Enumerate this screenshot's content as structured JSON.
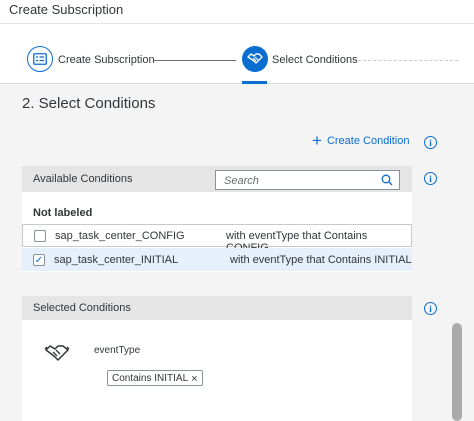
{
  "window": {
    "title": "Create Subscription"
  },
  "wizard": {
    "steps": [
      {
        "label": "Create Subscription",
        "icon": "form-icon",
        "state": "completed"
      },
      {
        "label": "Select Conditions",
        "icon": "handshake-icon",
        "state": "active"
      }
    ],
    "accent": "#0a6ed1"
  },
  "section": {
    "title": "2. Select Conditions"
  },
  "toolbar": {
    "create_condition_label": "Create Condition",
    "plus_glyph": "+"
  },
  "info_glyph": "i",
  "available": {
    "header": "Available Conditions",
    "search_placeholder": "Search",
    "group": "Not labeled",
    "rows": [
      {
        "name": "sap_task_center_CONFIG",
        "description": "with eventType that Contains CONFIG",
        "checked": false,
        "check_glyph": ""
      },
      {
        "name": "sap_task_center_INITIAL",
        "description": "with eventType that Contains INITIAL",
        "checked": true,
        "check_glyph": "✓"
      }
    ]
  },
  "selected": {
    "header": "Selected Conditions",
    "field": "eventType",
    "token": "Contains INITIAL",
    "token_remove": "×"
  }
}
